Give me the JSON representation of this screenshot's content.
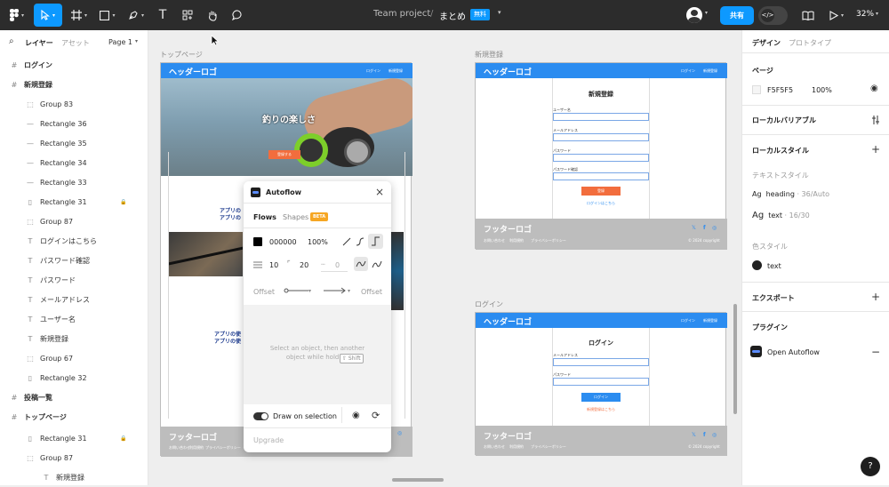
{
  "toolbar": {
    "project": "Team project",
    "separator": "/",
    "file": "まとめ",
    "plan_badge": "無料",
    "share": "共有",
    "zoom": "32%"
  },
  "left": {
    "tabs": [
      "レイヤー",
      "アセット"
    ],
    "page": "Page 1",
    "layers": [
      {
        "label": "ログイン",
        "icon": "frame-icon"
      },
      {
        "label": "新規登録",
        "icon": "frame-icon"
      },
      {
        "label": "Group 83",
        "icon": "group-icon"
      },
      {
        "label": "Rectangle 36",
        "icon": "line-icon"
      },
      {
        "label": "Rectangle 35",
        "icon": "line-icon"
      },
      {
        "label": "Rectangle 34",
        "icon": "line-icon"
      },
      {
        "label": "Rectangle 33",
        "icon": "line-icon"
      },
      {
        "label": "Rectangle 31",
        "icon": "rect-icon"
      },
      {
        "label": "Group 87",
        "icon": "group-icon"
      },
      {
        "label": "ログインはこちら",
        "icon": "text-icon"
      },
      {
        "label": "パスワード確認",
        "icon": "text-icon"
      },
      {
        "label": "パスワード",
        "icon": "text-icon"
      },
      {
        "label": "メールアドレス",
        "icon": "text-icon"
      },
      {
        "label": "ユーザー名",
        "icon": "text-icon"
      },
      {
        "label": "新規登録",
        "icon": "text-icon"
      },
      {
        "label": "Group 67",
        "icon": "group-icon"
      },
      {
        "label": "Rectangle 32",
        "icon": "rect-icon"
      },
      {
        "label": "投稿一覧",
        "icon": "frame-icon"
      },
      {
        "label": "トップページ",
        "icon": "frame-icon"
      },
      {
        "label": "Rectangle 31",
        "icon": "rect-icon"
      },
      {
        "label": "Group 87",
        "icon": "group-icon"
      },
      {
        "label": "新規登録",
        "icon": "text-icon"
      }
    ]
  },
  "canvas": {
    "top_label": "トップページ",
    "signup_label": "新規登録",
    "login_label": "ログイン",
    "header_logo": "ヘッダーロゴ",
    "footer_logo": "フッターロゴ",
    "nav_login": "ログイン",
    "nav_signup": "新規登録",
    "hero_text": "釣りの楽しさ",
    "hero_btn": "登録する",
    "app_text1": "アプリの",
    "app_text2": "アプリの",
    "app_text3": "アプリの使",
    "app_text4": "アプリの使",
    "signup_title": "新規登録",
    "f_user": "ユーザー名",
    "f_mail": "メールアドレス",
    "f_pass": "パスワード",
    "f_pass2": "パスワード確認",
    "signup_btn": "登録",
    "to_login": "ログインはこちら",
    "login_title": "ログイン",
    "login_btn": "ログイン",
    "to_signup": "新規登録はこちら",
    "foot_links": [
      "お問い合わせ",
      "利用規約",
      "プライバシーポリシー"
    ],
    "copyright": "© 2024 copyright"
  },
  "plugin": {
    "title": "Autoflow",
    "tab_flows": "Flows",
    "tab_shapes": "Shapes",
    "beta": "BETA",
    "color": "000000",
    "opacity": "100%",
    "stroke": "10",
    "radius": "20",
    "dash": "0",
    "offset_left": "Offset",
    "offset_right": "Offset",
    "hint": "Select an object, then another object while holding",
    "key": "⇧ Shift",
    "draw_on_selection": "Draw on selection",
    "upgrade": "Upgrade"
  },
  "right": {
    "tabs": [
      "デザイン",
      "プロトタイプ"
    ],
    "page_title": "ページ",
    "page_color": "F5F5F5",
    "page_opacity": "100%",
    "local_vars": "ローカルバリアブル",
    "local_styles": "ローカルスタイル",
    "text_styles": "テキストスタイル",
    "style1_name": "heading",
    "style1_meta": "· 36/Auto",
    "style2_name": "text",
    "style2_meta": "· 16/30",
    "color_styles": "色スタイル",
    "color1": "text",
    "export": "エクスポート",
    "plugins": "プラグイン",
    "plugin1": "Open Autoflow",
    "help": "?"
  },
  "colors": {
    "accent": "#0d99ff",
    "header_blue": "#2b8cf0",
    "orange": "#f26d3d",
    "beta": "#f6a623"
  }
}
